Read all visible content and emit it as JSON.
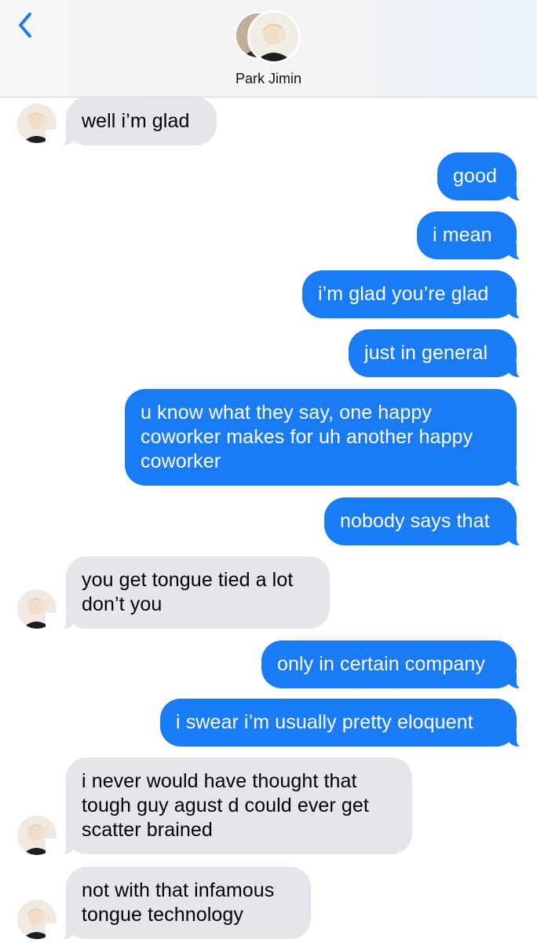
{
  "header": {
    "contact_name": "Park Jimin",
    "back_icon": "chevron-left-icon",
    "accent_color": "#1a7cf5"
  },
  "messages": [
    {
      "side": "in",
      "text": "well i’m glad"
    },
    {
      "side": "out",
      "text": "good"
    },
    {
      "side": "out",
      "text": "i mean"
    },
    {
      "side": "out",
      "text": "i’m glad you’re glad"
    },
    {
      "side": "out",
      "text": "just in general"
    },
    {
      "side": "out",
      "text": "u know what they say, one happy\ncoworker makes for uh another happy\ncoworker"
    },
    {
      "side": "out",
      "text": "nobody says that"
    },
    {
      "side": "in",
      "text": "you get tongue tied a lot\ndon’t you"
    },
    {
      "side": "out",
      "text": "only in certain company"
    },
    {
      "side": "out",
      "text": "i swear i’m usually pretty eloquent"
    },
    {
      "side": "in",
      "text": "i never would have thought that\ntough guy agust d could ever get\nscatter brained"
    },
    {
      "side": "in",
      "text": "not with that infamous\ntongue technology"
    }
  ],
  "colors": {
    "incoming_bubble": "#e5e5ea",
    "outgoing_bubble": "#1a7cf5",
    "outgoing_text": "#ffffff",
    "incoming_text": "#000000"
  }
}
